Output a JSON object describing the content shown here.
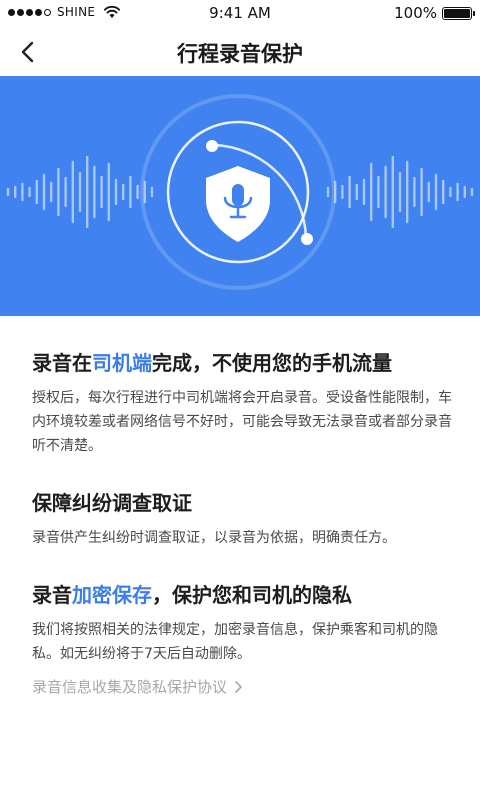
{
  "status_bar": {
    "carrier": "SHINE",
    "time": "9:41 AM",
    "battery": "100%",
    "battery_level": 1.0
  },
  "nav": {
    "title": "行程录音保护"
  },
  "hero": {
    "background_color": "#3f82f0",
    "icons": [
      "microphone-icon",
      "shield-icon"
    ]
  },
  "sections": [
    {
      "title_pre": "录音在",
      "title_highlight": "司机端",
      "title_post": "完成，不使用您的手机流量",
      "description": "授权后，每次行程进行中司机端将会开启录音。受设备性能限制，车内环境较差或者网络信号不好时，可能会导致无法录音或者部分录音听不清楚。"
    },
    {
      "title": "保障纠纷调查取证",
      "description": "录音供产生纠纷时调查取证，以录音为依据，明确责任方。"
    },
    {
      "title_pre": "录音",
      "title_highlight": "加密保存",
      "title_post": "，保护您和司机的隐私",
      "description": "我们将按照相关的法律规定，加密录音信息，保护乘客和司机的隐私。如无纠纷将于7天后自动删除。"
    }
  ],
  "footer": {
    "agreement_link": "录音信息收集及隐私保护协议"
  },
  "colors": {
    "accent": "#3c7ee8",
    "link_gray": "#a8a8a8"
  }
}
